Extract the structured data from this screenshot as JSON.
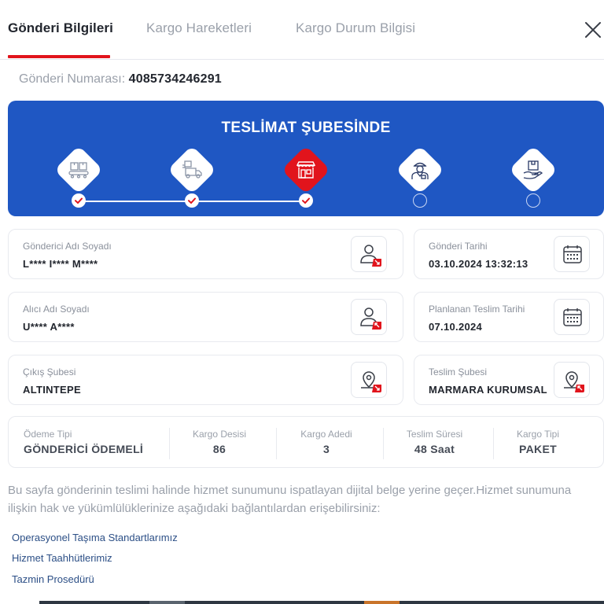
{
  "tabs": [
    {
      "label": "Gönderi Bilgileri",
      "active": true
    },
    {
      "label": "Kargo Hareketleri",
      "active": false
    },
    {
      "label": "Kargo Durum Bilgisi",
      "active": false
    }
  ],
  "tracking": {
    "label": "Gönderi Numarası:",
    "number": "4085734246291"
  },
  "status": {
    "title": "TESLİMAT ŞUBESİNDE",
    "current_step": 3,
    "total_steps": 5,
    "steps": [
      {
        "icon": "boxes-conveyor-icon",
        "completed": true
      },
      {
        "icon": "delivery-truck-icon",
        "completed": true
      },
      {
        "icon": "store-branch-icon",
        "completed": true
      },
      {
        "icon": "courier-icon",
        "completed": false
      },
      {
        "icon": "hand-package-icon",
        "completed": false
      }
    ]
  },
  "sender": {
    "label": "Gönderici Adı Soyadı",
    "value": "L**** I**** M****"
  },
  "receiver": {
    "label": "Alıcı Adı Soyadı",
    "value": "U**** A****"
  },
  "origin_branch": {
    "label": "Çıkış Şubesi",
    "value": "ALTINTEPE"
  },
  "ship_date": {
    "label": "Gönderi Tarihi",
    "value": "03.10.2024 13:32:13"
  },
  "planned_date": {
    "label": "Planlanan Teslim Tarihi",
    "value": "07.10.2024"
  },
  "delivery_branch": {
    "label": "Teslim Şubesi",
    "value": "MARMARA KURUMSAL"
  },
  "summary": {
    "payment_type": {
      "label": "Ödeme Tipi",
      "value": "GÖNDERİCİ ÖDEMELİ"
    },
    "desi": {
      "label": "Kargo Desisi",
      "value": "86"
    },
    "count": {
      "label": "Kargo Adedi",
      "value": "3"
    },
    "delivery_time": {
      "label": "Teslim Süresi",
      "value": "48 Saat"
    },
    "cargo_type": {
      "label": "Kargo Tipi",
      "value": "PAKET"
    }
  },
  "disclaimer": "Bu sayfa gönderinin teslimi halinde hizmet sunumunu ispatlayan dijital belge yerine geçer.Hizmet sunumuna ilişkin hak ve yükümlülüklerinize aşağıdaki bağlantılardan erişebilirsiniz:",
  "links": [
    "Operasyonel Taşıma Standartlarımız",
    "Hizmet Taahhütlerimiz",
    "Tazmin Prosedürü"
  ],
  "colors": {
    "brand_blue": "#1f57c3",
    "brand_red": "#e1141c",
    "link": "#2c4f86"
  }
}
